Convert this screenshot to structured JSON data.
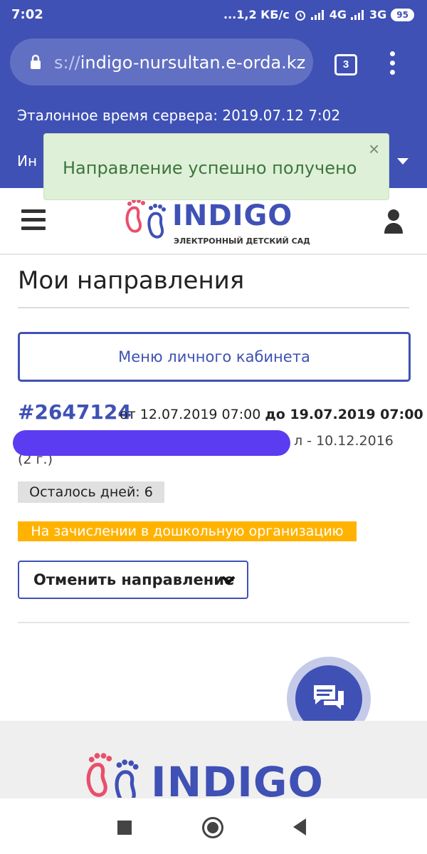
{
  "status_bar": {
    "time": "7:02",
    "right": "...1,2 КБ/с",
    "net1": "4G",
    "net2": "3G",
    "battery": "95"
  },
  "browser": {
    "url_scheme": "s://",
    "url_host": "indigo-nursultan.e-orda.kz",
    "tab_count": "3"
  },
  "server": {
    "time_label": "Эталонное время сервера: 2019.07.12 7:02",
    "second_line": "Ин"
  },
  "toast": {
    "message": "Направление успешно получено",
    "close": "×"
  },
  "header": {
    "logo_word": "INDIGO",
    "logo_sub": "ЭЛЕКТРОННЫЙ ДЕТСКИЙ САД"
  },
  "page": {
    "title": "Мои направления",
    "menu_button": "Меню личного кабинета"
  },
  "referral": {
    "number": "#2647124",
    "from_label": "от 12.07.2019 07:00",
    "to_label": "до 19.07.2019 07:00",
    "child_suffix": "л - 10.12.2016 (2 г.)",
    "days_left": "Осталось дней: 6",
    "status": "На зачислении в дошкольную организацию",
    "cancel_button": "Отменить направление"
  },
  "footer": {
    "logo_word": "INDIGO"
  },
  "colors": {
    "brand": "#3f51b5",
    "toast_bg": "#dff0d8",
    "status_bg": "#ffb300"
  }
}
